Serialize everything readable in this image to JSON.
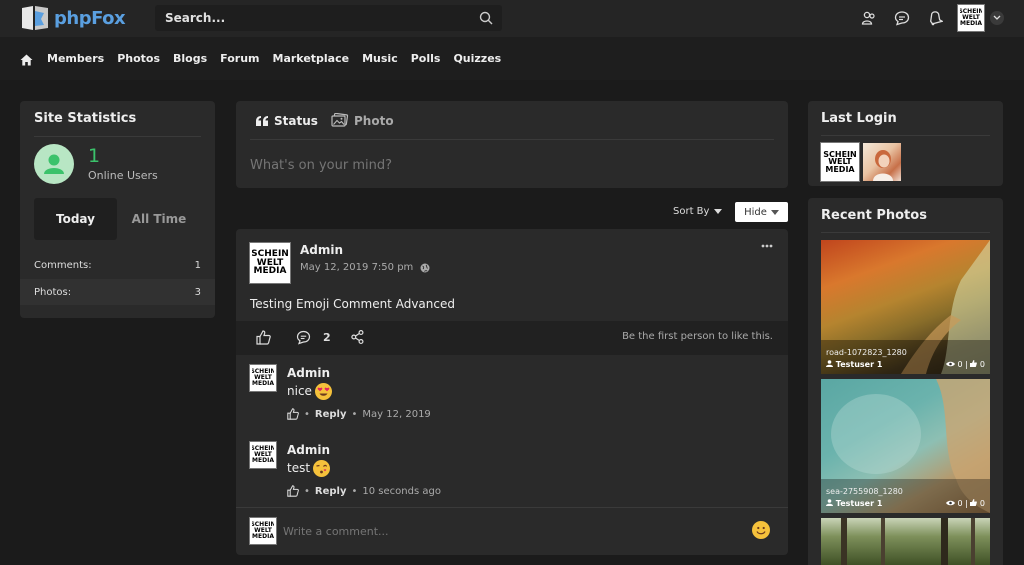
{
  "brand": {
    "name": "phpFox"
  },
  "search": {
    "placeholder": "Search..."
  },
  "nav": {
    "items": [
      "Members",
      "Photos",
      "Blogs",
      "Forum",
      "Marketplace",
      "Music",
      "Polls",
      "Quizzes"
    ]
  },
  "logo_text": {
    "l1": "SCHEIN",
    "l2": "WELT",
    "l3": "MEDIA"
  },
  "stats": {
    "title": "Site Statistics",
    "online_count": "1",
    "online_label": "Online Users",
    "tab_today": "Today",
    "tab_all": "All Time",
    "rows": [
      {
        "label": "Comments:",
        "value": "1"
      },
      {
        "label": "Photos:",
        "value": "3"
      }
    ]
  },
  "composer": {
    "tab_status": "Status",
    "tab_photo": "Photo",
    "placeholder": "What's on your mind?"
  },
  "feed": {
    "sort_label": "Sort By",
    "hide_label": "Hide"
  },
  "post": {
    "author": "Admin",
    "date": "May 12, 2019 7:50 pm",
    "text": "Testing Emoji Comment Advanced",
    "comment_count": "2",
    "like_text": "Be the first person to like this."
  },
  "comments": [
    {
      "author": "Admin",
      "text": "nice",
      "reply": "Reply",
      "time": "May 12, 2019"
    },
    {
      "author": "Admin",
      "text": "test",
      "reply": "Reply",
      "time": "10 seconds ago"
    }
  ],
  "comment_box": {
    "placeholder": "Write a comment..."
  },
  "last_login": {
    "title": "Last Login"
  },
  "recent_photos": {
    "title": "Recent Photos",
    "items": [
      {
        "name": "road-1072823_1280",
        "user": "Testuser 1",
        "views": "0",
        "likes": "0"
      },
      {
        "name": "sea-2755908_1280",
        "user": "Testuser 1",
        "views": "0",
        "likes": "0"
      }
    ]
  },
  "colors": {
    "accent": "#5a9fe0",
    "online": "#3bc26b",
    "panel": "#2a2a2a",
    "background": "#1b1b1b"
  }
}
